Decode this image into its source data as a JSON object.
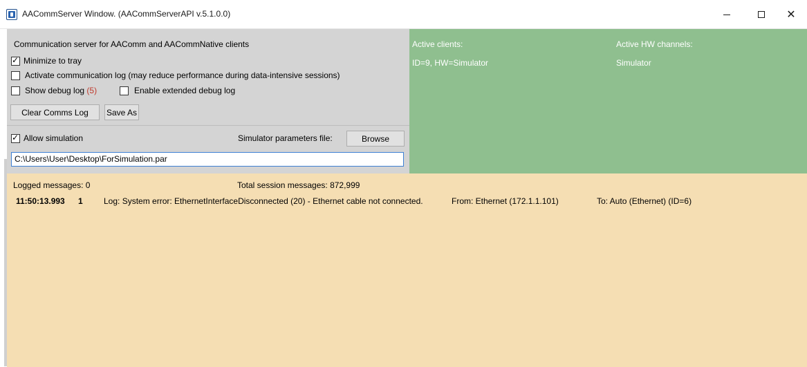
{
  "window": {
    "title": "AACommServer Window. (AACommServerAPI v.5.1.0.0)",
    "controls": {
      "minimize": "minimize",
      "maximize": "maximize",
      "close": "close"
    }
  },
  "settings": {
    "heading": "Communication server for AAComm and AACommNative clients",
    "minimize_to_tray": {
      "label": "Minimize to tray",
      "checked": true
    },
    "activate_comm_log": {
      "label": "Activate communication log (may reduce performance during data-intensive sessions)",
      "checked": false
    },
    "show_debug_log": {
      "label": "Show debug log",
      "count": "(5)",
      "checked": false
    },
    "extended_debug_log": {
      "label": "Enable extended debug log",
      "checked": false
    },
    "clear_comms_log_label": "Clear Comms Log",
    "save_as_label": "Save As"
  },
  "simulation": {
    "allow_simulation": {
      "label": "Allow simulation",
      "checked": true
    },
    "params_file_label": "Simulator parameters file:",
    "browse_label": "Browse",
    "params_file_path": "C:\\Users\\User\\Desktop\\ForSimulation.par"
  },
  "status": {
    "active_clients_header": "Active clients:",
    "active_hw_channels_header": "Active HW channels:",
    "clients": [
      "ID=9, HW=Simulator"
    ],
    "hw_channels": [
      "Simulator"
    ]
  },
  "log": {
    "logged_messages": "Logged messages: 0",
    "total_session_messages": "Total session messages: 872,999",
    "entries": [
      {
        "time": "11:50:13.993",
        "count": "1",
        "message": "Log: System error: EthernetInterfaceDisconnected (20) - Ethernet cable not connected.",
        "from": "From: Ethernet (172.1.1.101)",
        "to": "To: Auto (Ethernet) (ID=6)"
      }
    ]
  },
  "colors": {
    "settings_panel_bg": "#d4d4d4",
    "status_panel_bg": "#8fbf8f",
    "log_panel_bg": "#f5deb3",
    "debug_count": "#c0392b",
    "input_border": "#3c7fd4"
  },
  "icons": {
    "app": "app-icon",
    "minimize": "minimize-icon",
    "maximize": "maximize-icon",
    "close": "close-icon",
    "checkbox_checked": "checkmark-icon"
  }
}
